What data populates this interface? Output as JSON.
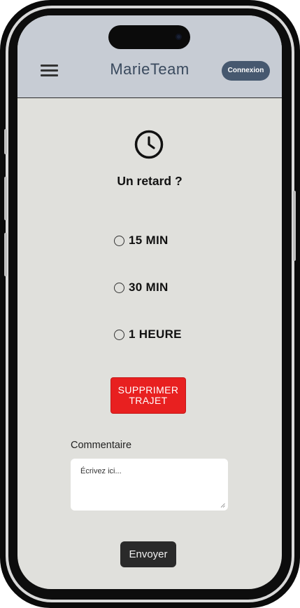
{
  "header": {
    "title": "MarieTeam",
    "login_label": "Connexion"
  },
  "main": {
    "heading": "Un retard ?",
    "options": [
      {
        "label": "15 MIN"
      },
      {
        "label": "30 MIN"
      },
      {
        "label": "1 HEURE"
      }
    ],
    "delete_line1": "SUPPRIMER",
    "delete_line2": "TRAJET",
    "comment_label": "Commentaire",
    "comment_placeholder": "Écrivez ici...",
    "send_label": "Envoyer"
  },
  "icons": {
    "menu": "hamburger-menu-icon",
    "clock": "clock-icon"
  },
  "colors": {
    "header_bg": "#c7ccd4",
    "body_bg": "#e0e0dc",
    "login_bg": "#46586f",
    "delete_bg": "#e82020",
    "send_bg": "#2a2a2a"
  }
}
